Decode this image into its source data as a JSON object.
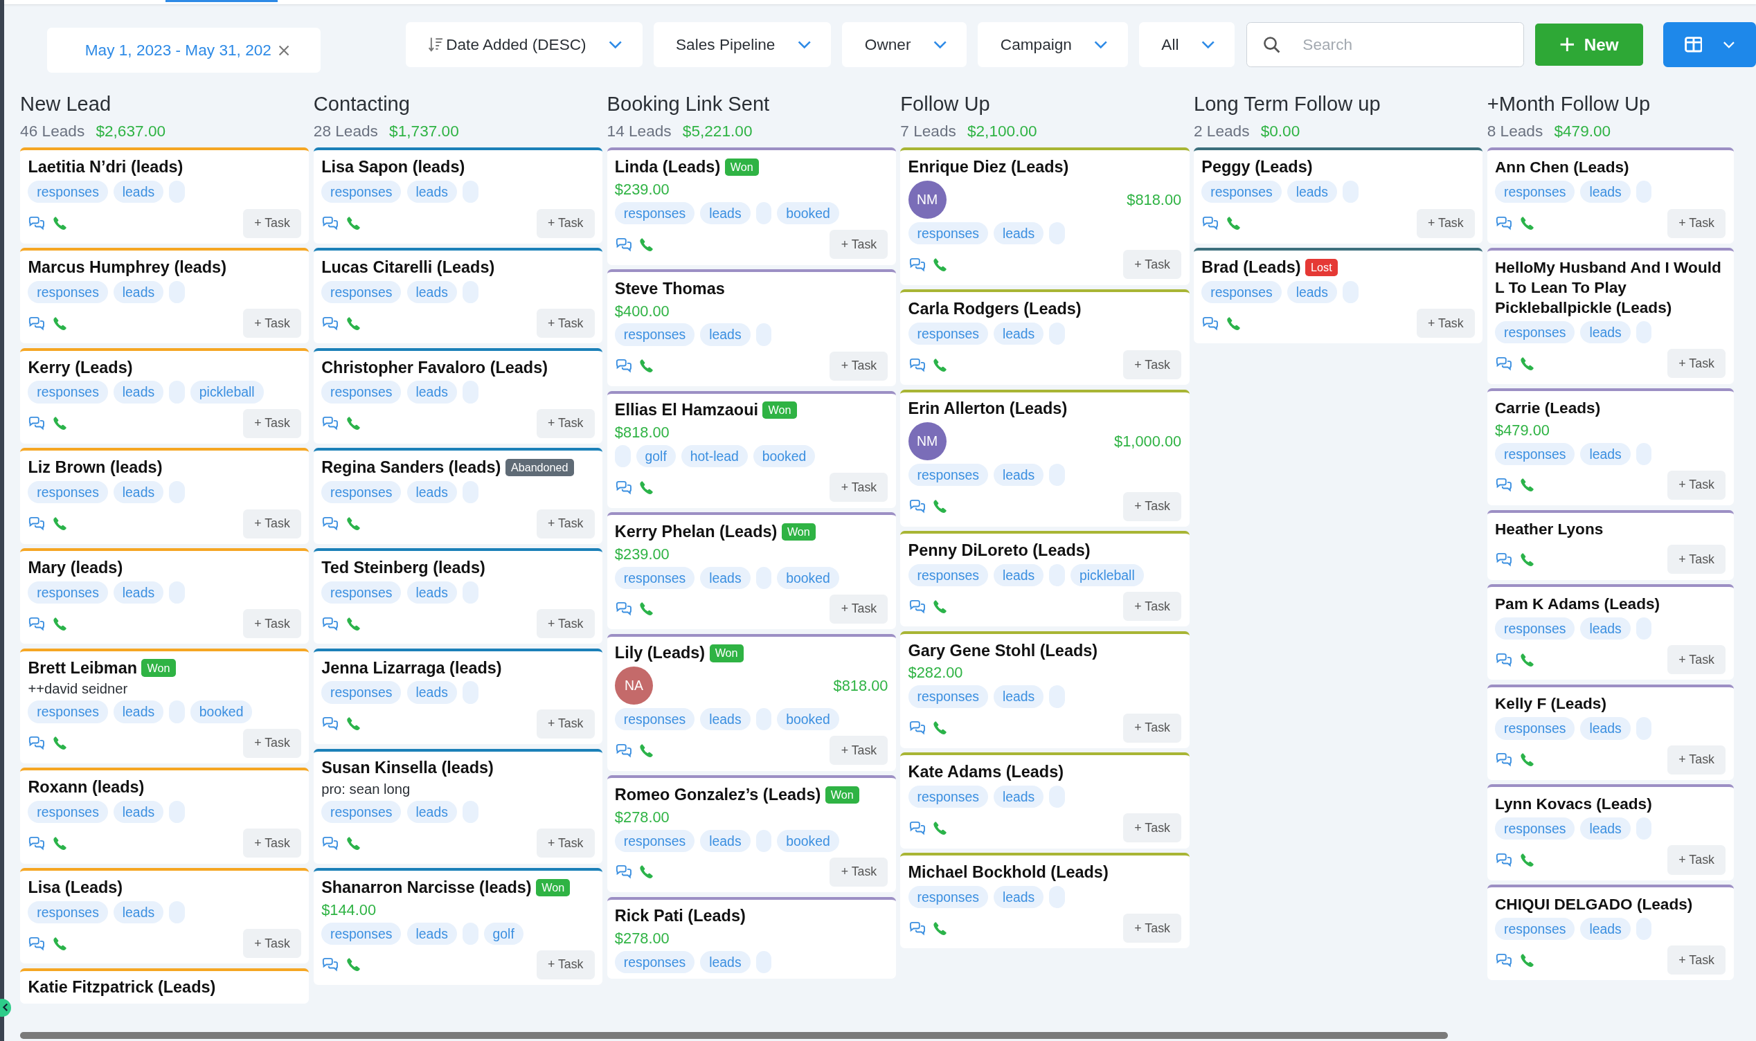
{
  "toolbar": {
    "date_range": "May 1, 2023 - May 31, 202",
    "filters": [
      {
        "kind": "sort",
        "label": "Date Added (DESC)"
      },
      {
        "kind": "dropdown",
        "label": "Sales Pipeline"
      },
      {
        "kind": "dropdown",
        "label": "Owner"
      },
      {
        "kind": "dropdown",
        "label": "Campaign"
      },
      {
        "kind": "dropdown",
        "label": "All"
      }
    ],
    "search": {
      "placeholder": "Search"
    },
    "new_button": "New"
  },
  "columns": [
    {
      "title": "New Lead",
      "count": "46 Leads",
      "total": "$2,637.00",
      "color": "#f5a623",
      "cards": [
        {
          "name": "Laetitia N’dri (leads)",
          "task": "+ Task",
          "tags": [
            {
              "kind": "tag",
              "label": "responses"
            },
            {
              "kind": "tag",
              "label": "leads"
            },
            {
              "kind": "blank"
            }
          ]
        },
        {
          "name": "Marcus Humphrey (leads)",
          "task": "+ Task",
          "tags": [
            {
              "kind": "tag",
              "label": "responses"
            },
            {
              "kind": "tag",
              "label": "leads"
            },
            {
              "kind": "blank"
            }
          ]
        },
        {
          "name": "Kerry (Leads)",
          "task": "+ Task",
          "tags": [
            {
              "kind": "tag",
              "label": "responses"
            },
            {
              "kind": "tag",
              "label": "leads"
            },
            {
              "kind": "blank"
            },
            {
              "kind": "tag",
              "label": "pickleball"
            }
          ]
        },
        {
          "name": "Liz Brown (leads)",
          "task": "+ Task",
          "tags": [
            {
              "kind": "tag",
              "label": "responses"
            },
            {
              "kind": "tag",
              "label": "leads"
            },
            {
              "kind": "blank"
            }
          ]
        },
        {
          "name": "Mary (leads)",
          "task": "+ Task",
          "tags": [
            {
              "kind": "tag",
              "label": "responses"
            },
            {
              "kind": "tag",
              "label": "leads"
            },
            {
              "kind": "blank"
            }
          ]
        },
        {
          "name": "Brett Leibman",
          "task": "+ Task",
          "badge": {
            "kind": "won",
            "label": "Won"
          },
          "note": "++david seidner",
          "tags": [
            {
              "kind": "tag",
              "label": "responses"
            },
            {
              "kind": "tag",
              "label": "leads"
            },
            {
              "kind": "blank"
            },
            {
              "kind": "tag",
              "label": "booked"
            }
          ]
        },
        {
          "name": "Roxann (leads)",
          "task": "+ Task",
          "tags": [
            {
              "kind": "tag",
              "label": "responses"
            },
            {
              "kind": "tag",
              "label": "leads"
            },
            {
              "kind": "blank"
            }
          ]
        },
        {
          "name": "Lisa (Leads)",
          "task": "+ Task",
          "tags": [
            {
              "kind": "tag",
              "label": "responses"
            },
            {
              "kind": "tag",
              "label": "leads"
            },
            {
              "kind": "blank"
            }
          ]
        },
        {
          "name": "Katie Fitzpatrick (Leads)"
        }
      ]
    },
    {
      "title": "Contacting",
      "count": "28 Leads",
      "total": "$1,737.00",
      "color": "#1b80b8",
      "cards": [
        {
          "name": "Lisa Sapon (leads)",
          "task": "+ Task",
          "tags": [
            {
              "kind": "tag",
              "label": "responses"
            },
            {
              "kind": "tag",
              "label": "leads"
            },
            {
              "kind": "blank"
            }
          ]
        },
        {
          "name": "Lucas Citarelli (Leads)",
          "task": "+ Task",
          "tags": [
            {
              "kind": "tag",
              "label": "responses"
            },
            {
              "kind": "tag",
              "label": "leads"
            },
            {
              "kind": "blank"
            }
          ]
        },
        {
          "name": "Christopher Favaloro (Leads)",
          "task": "+ Task",
          "tags": [
            {
              "kind": "tag",
              "label": "responses"
            },
            {
              "kind": "tag",
              "label": "leads"
            },
            {
              "kind": "blank"
            }
          ]
        },
        {
          "name": "Regina Sanders (leads)",
          "task": "+ Task",
          "badge": {
            "kind": "abandoned",
            "label": "Abandoned"
          },
          "tags": [
            {
              "kind": "tag",
              "label": "responses"
            },
            {
              "kind": "tag",
              "label": "leads"
            },
            {
              "kind": "blank"
            }
          ]
        },
        {
          "name": "Ted Steinberg (leads)",
          "task": "+ Task",
          "tags": [
            {
              "kind": "tag",
              "label": "responses"
            },
            {
              "kind": "tag",
              "label": "leads"
            },
            {
              "kind": "blank"
            }
          ]
        },
        {
          "name": "Jenna Lizarraga (leads)",
          "task": "+ Task",
          "tags": [
            {
              "kind": "tag",
              "label": "responses"
            },
            {
              "kind": "tag",
              "label": "leads"
            },
            {
              "kind": "blank"
            }
          ]
        },
        {
          "name": "Susan Kinsella (leads)",
          "task": "+ Task",
          "note": "pro: sean long",
          "tags": [
            {
              "kind": "tag",
              "label": "responses"
            },
            {
              "kind": "tag",
              "label": "leads"
            },
            {
              "kind": "blank"
            }
          ]
        },
        {
          "name": "Shanarron Narcisse (leads)",
          "task": "+ Task",
          "badge": {
            "kind": "won",
            "label": "Won"
          },
          "amount": "$144.00",
          "tags": [
            {
              "kind": "tag",
              "label": "responses"
            },
            {
              "kind": "tag",
              "label": "leads"
            },
            {
              "kind": "blank"
            },
            {
              "kind": "tag",
              "label": "golf"
            }
          ]
        }
      ]
    },
    {
      "title": "Booking Link Sent",
      "count": "14 Leads",
      "total": "$5,221.00",
      "color": "#9c8fc4",
      "cards": [
        {
          "name": "Linda (Leads)",
          "task": "+ Task",
          "badge": {
            "kind": "won",
            "label": "Won"
          },
          "amount": "$239.00",
          "tags": [
            {
              "kind": "tag",
              "label": "responses"
            },
            {
              "kind": "tag",
              "label": "leads"
            },
            {
              "kind": "blank"
            },
            {
              "kind": "tag",
              "label": "booked"
            }
          ]
        },
        {
          "name": "Steve Thomas",
          "task": "+ Task",
          "amount": "$400.00",
          "tags": [
            {
              "kind": "tag",
              "label": "responses"
            },
            {
              "kind": "tag",
              "label": "leads"
            },
            {
              "kind": "blank"
            }
          ]
        },
        {
          "name": "Ellias El Hamzaoui",
          "task": "+ Task",
          "badge": {
            "kind": "won",
            "label": "Won"
          },
          "amount": "$818.00",
          "tags": [
            {
              "kind": "blank"
            },
            {
              "kind": "tag",
              "label": "golf"
            },
            {
              "kind": "tag",
              "label": "hot-lead"
            },
            {
              "kind": "tag",
              "label": "booked"
            }
          ]
        },
        {
          "name": "Kerry Phelan (Leads)",
          "task": "+ Task",
          "badge": {
            "kind": "won",
            "label": "Won"
          },
          "amount": "$239.00",
          "tags": [
            {
              "kind": "tag",
              "label": "responses"
            },
            {
              "kind": "tag",
              "label": "leads"
            },
            {
              "kind": "blank"
            },
            {
              "kind": "tag",
              "label": "booked"
            }
          ]
        },
        {
          "name": "Lily (Leads)",
          "task": "+ Task",
          "badge": {
            "kind": "won",
            "label": "Won"
          },
          "avatar": {
            "initials": "NA",
            "color": "#c46a6a"
          },
          "amount": "$818.00",
          "tags": [
            {
              "kind": "tag",
              "label": "responses"
            },
            {
              "kind": "tag",
              "label": "leads"
            },
            {
              "kind": "blank"
            },
            {
              "kind": "tag",
              "label": "booked"
            }
          ]
        },
        {
          "name": "Romeo Gonzalez’s (Leads)",
          "task": "+ Task",
          "badge": {
            "kind": "won",
            "label": "Won"
          },
          "amount": "$278.00",
          "tags": [
            {
              "kind": "tag",
              "label": "responses"
            },
            {
              "kind": "tag",
              "label": "leads"
            },
            {
              "kind": "blank"
            },
            {
              "kind": "tag",
              "label": "booked"
            }
          ]
        },
        {
          "name": "Rick Pati (Leads)",
          "amount": "$278.00",
          "tags": [
            {
              "kind": "tag",
              "label": "responses"
            },
            {
              "kind": "tag",
              "label": "leads"
            },
            {
              "kind": "blank"
            }
          ]
        }
      ]
    },
    {
      "title": "Follow Up",
      "count": "7 Leads",
      "total": "$2,100.00",
      "color": "#a8b534",
      "cards": [
        {
          "name": "Enrique Diez (Leads)",
          "task": "+ Task",
          "avatar": {
            "initials": "NM",
            "color": "#7a6db8"
          },
          "amount": "$818.00",
          "tags": [
            {
              "kind": "tag",
              "label": "responses"
            },
            {
              "kind": "tag",
              "label": "leads"
            },
            {
              "kind": "blank"
            }
          ]
        },
        {
          "name": "Carla Rodgers (Leads)",
          "task": "+ Task",
          "tags": [
            {
              "kind": "tag",
              "label": "responses"
            },
            {
              "kind": "tag",
              "label": "leads"
            },
            {
              "kind": "blank"
            }
          ]
        },
        {
          "name": "Erin Allerton (Leads)",
          "task": "+ Task",
          "avatar": {
            "initials": "NM",
            "color": "#7a6db8"
          },
          "amount": "$1,000.00",
          "tags": [
            {
              "kind": "tag",
              "label": "responses"
            },
            {
              "kind": "tag",
              "label": "leads"
            },
            {
              "kind": "blank"
            }
          ]
        },
        {
          "name": "Penny DiLoreto (Leads)",
          "task": "+ Task",
          "tags": [
            {
              "kind": "tag",
              "label": "responses"
            },
            {
              "kind": "tag",
              "label": "leads"
            },
            {
              "kind": "blank"
            },
            {
              "kind": "tag",
              "label": "pickleball"
            }
          ]
        },
        {
          "name": "Gary Gene Stohl (Leads)",
          "task": "+ Task",
          "amount": "$282.00",
          "tags": [
            {
              "kind": "tag",
              "label": "responses"
            },
            {
              "kind": "tag",
              "label": "leads"
            },
            {
              "kind": "blank"
            }
          ]
        },
        {
          "name": "Kate Adams (Leads)",
          "task": "+ Task",
          "tags": [
            {
              "kind": "tag",
              "label": "responses"
            },
            {
              "kind": "tag",
              "label": "leads"
            },
            {
              "kind": "blank"
            }
          ]
        },
        {
          "name": "Michael Bockhold (Leads)",
          "task": "+ Task",
          "tags": [
            {
              "kind": "tag",
              "label": "responses"
            },
            {
              "kind": "tag",
              "label": "leads"
            },
            {
              "kind": "blank"
            }
          ]
        }
      ]
    },
    {
      "title": "Long Term Follow up",
      "count": "2 Leads",
      "total": "$0.00",
      "color": "#3c6f7c",
      "cards": [
        {
          "name": "Peggy (Leads)",
          "task": "+ Task",
          "tags": [
            {
              "kind": "tag",
              "label": "responses"
            },
            {
              "kind": "tag",
              "label": "leads"
            },
            {
              "kind": "blank"
            }
          ]
        },
        {
          "name": "Brad (Leads)",
          "task": "+ Task",
          "badge": {
            "kind": "lost",
            "label": "Lost"
          },
          "tags": [
            {
              "kind": "tag",
              "label": "responses"
            },
            {
              "kind": "tag",
              "label": "leads"
            },
            {
              "kind": "blank"
            }
          ]
        }
      ]
    },
    {
      "title": "+Month Follow Up",
      "count": "8 Leads",
      "total": "$479.00",
      "color": "#9c8fc4",
      "cards": [
        {
          "name": "Ann Chen (Leads)",
          "task": "+ Task",
          "tags": [
            {
              "kind": "tag",
              "label": "responses"
            },
            {
              "kind": "tag",
              "label": "leads"
            },
            {
              "kind": "blank"
            }
          ]
        },
        {
          "name": "HelloMy Husband And I Would L To Lean To Play Pickleballpickle (Leads)",
          "task": "+ Task",
          "tags": [
            {
              "kind": "tag",
              "label": "responses"
            },
            {
              "kind": "tag",
              "label": "leads"
            },
            {
              "kind": "blank"
            }
          ]
        },
        {
          "name": "Carrie (Leads)",
          "task": "+ Task",
          "amount": "$479.00",
          "tags": [
            {
              "kind": "tag",
              "label": "responses"
            },
            {
              "kind": "tag",
              "label": "leads"
            },
            {
              "kind": "blank"
            }
          ]
        },
        {
          "name": "Heather Lyons",
          "task": "+ Task"
        },
        {
          "name": "Pam K Adams (Leads)",
          "task": "+ Task",
          "tags": [
            {
              "kind": "tag",
              "label": "responses"
            },
            {
              "kind": "tag",
              "label": "leads"
            },
            {
              "kind": "blank"
            }
          ]
        },
        {
          "name": "Kelly F (Leads)",
          "task": "+ Task",
          "tags": [
            {
              "kind": "tag",
              "label": "responses"
            },
            {
              "kind": "tag",
              "label": "leads"
            },
            {
              "kind": "blank"
            }
          ]
        },
        {
          "name": "Lynn Kovacs (Leads)",
          "task": "+ Task",
          "tags": [
            {
              "kind": "tag",
              "label": "responses"
            },
            {
              "kind": "tag",
              "label": "leads"
            },
            {
              "kind": "blank"
            }
          ]
        },
        {
          "name": "CHIQUI DELGADO (Leads)",
          "task": "+ Task",
          "tags": [
            {
              "kind": "tag",
              "label": "responses"
            },
            {
              "kind": "tag",
              "label": "leads"
            },
            {
              "kind": "blank"
            }
          ]
        }
      ]
    }
  ]
}
